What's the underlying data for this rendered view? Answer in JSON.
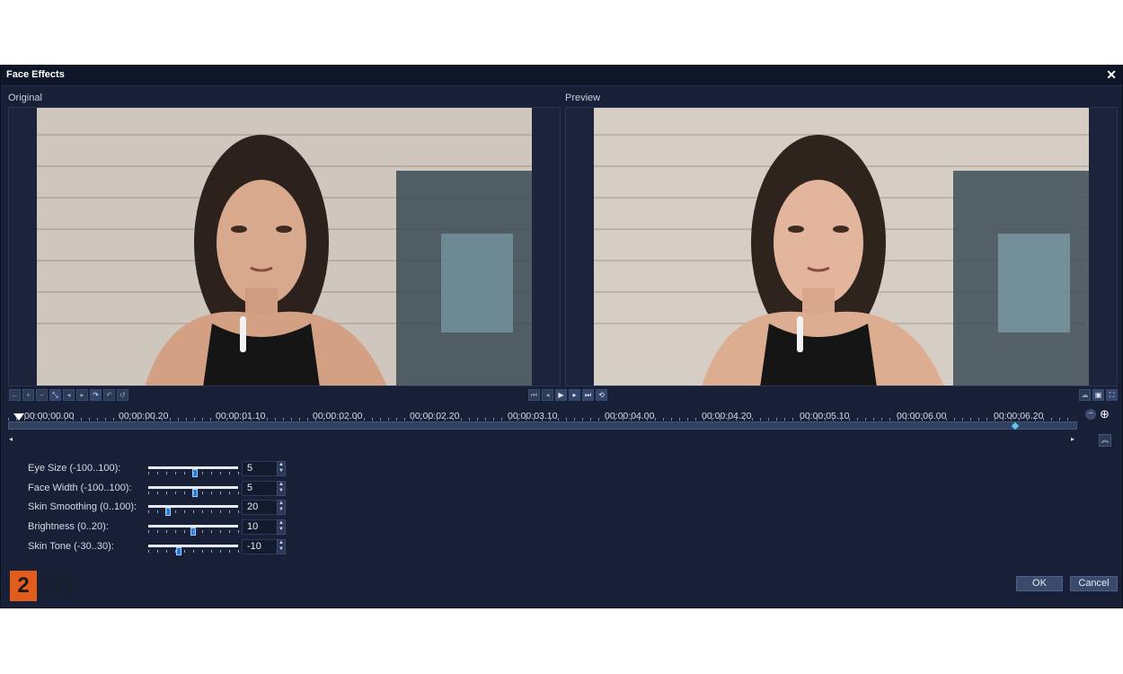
{
  "dialog": {
    "title": "Face Effects"
  },
  "panes": {
    "original_label": "Original",
    "preview_label": "Preview"
  },
  "timeline": {
    "timecodes": [
      "00:00:00.00",
      "00:00:00.20",
      "00:00:01.10",
      "00:00:02.00",
      "00:00:02.20",
      "00:00:03.10",
      "00:00:04.00",
      "00:00:04.20",
      "00:00:05.10",
      "00:00:06.00",
      "00:00:06.20"
    ]
  },
  "sliders": [
    {
      "label": "Eye Size (-100..100):",
      "value": "5",
      "min": -100,
      "max": 100,
      "num": 5
    },
    {
      "label": "Face Width (-100..100):",
      "value": "5",
      "min": -100,
      "max": 100,
      "num": 5
    },
    {
      "label": "Skin Smoothing (0..100):",
      "value": "20",
      "min": 0,
      "max": 100,
      "num": 20
    },
    {
      "label": "Brightness  (0..20):",
      "value": "10",
      "min": 0,
      "max": 20,
      "num": 10
    },
    {
      "label": "Skin Tone  (-30..30):",
      "value": "-10",
      "min": -30,
      "max": 30,
      "num": -10
    }
  ],
  "buttons": {
    "ok": "OK",
    "cancel": "Cancel"
  },
  "logo": {
    "digit": "2",
    "text": "GO",
    "accent": "#e25c1c"
  },
  "colors": {
    "accent_blue": "#1f7be0",
    "panel": "#172036"
  }
}
